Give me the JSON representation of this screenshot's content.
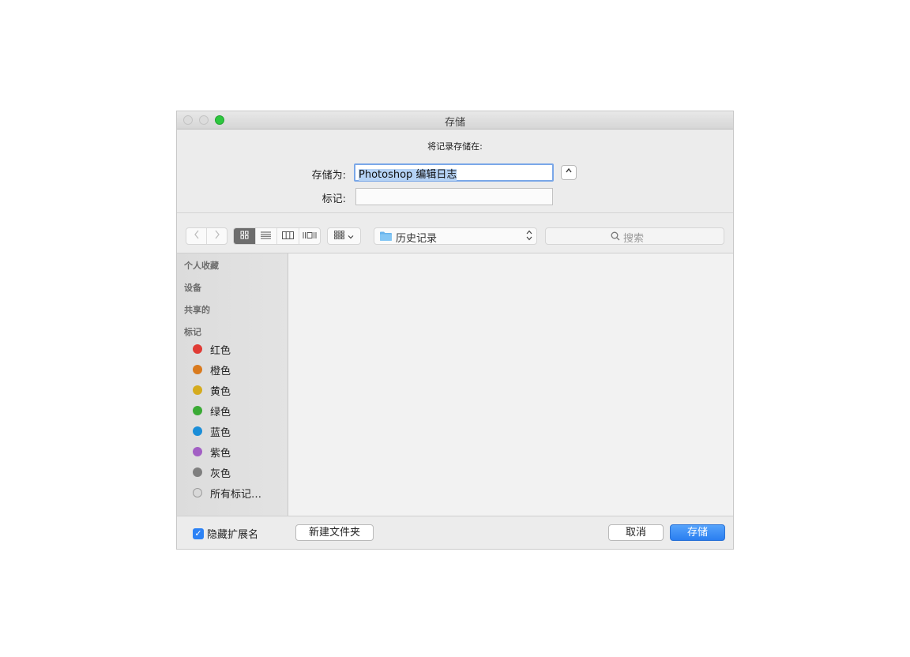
{
  "window": {
    "title": "存储"
  },
  "prompt": "将记录存储在:",
  "form": {
    "save_as_label": "存储为:",
    "save_as_value": "Photoshop 编辑日志",
    "tags_label": "标记:"
  },
  "toolbar": {
    "back_icon": "chevron-left-icon",
    "forward_icon": "chevron-right-icon",
    "views": [
      "icon-view",
      "list-view",
      "column-view",
      "cover-flow-view"
    ],
    "active_view": "icon-view",
    "group_icon": "group-by-icon",
    "location": "历史记录",
    "search_placeholder": "搜索"
  },
  "sidebar": {
    "sections": [
      "个人收藏",
      "设备",
      "共享的",
      "标记"
    ],
    "tags": [
      {
        "label": "红色",
        "color": "#e03b35"
      },
      {
        "label": "橙色",
        "color": "#d97a1d"
      },
      {
        "label": "黄色",
        "color": "#d5ab1e"
      },
      {
        "label": "绿色",
        "color": "#3aaa35"
      },
      {
        "label": "蓝色",
        "color": "#1b8ed8"
      },
      {
        "label": "紫色",
        "color": "#a25fc4"
      },
      {
        "label": "灰色",
        "color": "#7f7f7f"
      },
      {
        "label": "所有标记…"
      }
    ]
  },
  "bottom": {
    "hide_extension_label": "隐藏扩展名",
    "hide_extension_checked": true,
    "new_folder": "新建文件夹",
    "cancel": "取消",
    "save": "存储"
  }
}
